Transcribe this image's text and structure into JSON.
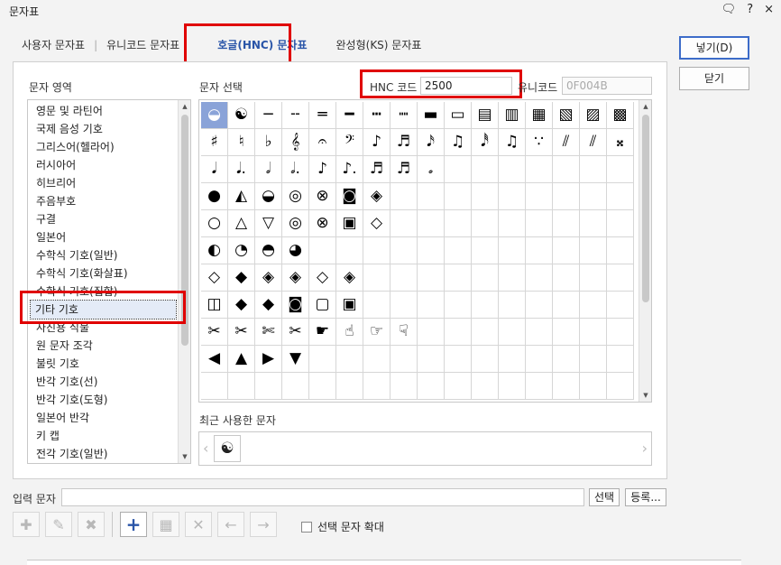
{
  "window": {
    "title": "문자표",
    "icons": [
      "?",
      "×"
    ]
  },
  "tabs": [
    {
      "label": "사용자 문자표",
      "active": false
    },
    {
      "label": "유니코드 문자표",
      "active": false
    },
    {
      "label": "호글(HNC) 문자표",
      "active": true
    },
    {
      "label": "완성형(KS) 문자표",
      "active": false
    }
  ],
  "labels": {
    "region": "문자 영역",
    "select": "문자 선택",
    "hnc_code": "HNC 코드",
    "unicode": "유니코드",
    "recent": "최근 사용한 문자",
    "input": "입력 문자"
  },
  "inputs": {
    "hnc_code": "2500",
    "unicode": "0F004B",
    "input_text": ""
  },
  "regions": [
    "영문 및 라틴어",
    "국제 음성 기호",
    "그리스어(헬라어)",
    "러시아어",
    "히브리어",
    "주음부호",
    "구결",
    "일본어",
    "수학식 기호(일반)",
    "수학식 기호(화살표)",
    "수학식 기호(집합)",
    "기타 기호",
    "사진용 식물",
    "원 문자 조각",
    "불릿 기호",
    "반각 기호(선)",
    "반각 기호(도형)",
    "일본어 반각",
    "키 캡",
    "전각 기호(일반)"
  ],
  "selected_region": "기타 기호",
  "grid_rows": [
    [
      "◒",
      "☯",
      "─",
      "╌",
      "═",
      "━",
      "┅",
      "┉",
      "▬",
      "▭",
      "▤",
      "▥",
      "▦",
      "▧",
      "▨",
      "▩"
    ],
    [
      "♯",
      "♮",
      "♭",
      "𝄞",
      "𝄐",
      "𝄢",
      "♪",
      "♬",
      "𝅘𝅥𝅯",
      "♫",
      "𝅘𝅥𝅰",
      "♫",
      "∵",
      "⫽",
      "⫽",
      "𝄪"
    ],
    [
      "𝅘𝅥",
      "𝅘𝅥.",
      "𝅗𝅥",
      "𝅗𝅥.",
      "♪",
      "♪.",
      "♬",
      "♬",
      "𝅗",
      "",
      "",
      "",
      "",
      "",
      "",
      ""
    ],
    [
      "●",
      "◭",
      "◒",
      "◎",
      "⊗",
      "◙",
      "◈",
      "",
      "",
      "",
      "",
      "",
      "",
      "",
      "",
      ""
    ],
    [
      "○",
      "△",
      "▽",
      "◎",
      "⊗",
      "▣",
      "◇",
      "",
      "",
      "",
      "",
      "",
      "",
      "",
      "",
      ""
    ],
    [
      "◐",
      "◔",
      "◓",
      "◕",
      "",
      "",
      "",
      "",
      "",
      "",
      "",
      "",
      "",
      "",
      "",
      ""
    ],
    [
      "◇",
      "◆",
      "◈",
      "◈",
      "◇",
      "◈",
      "",
      "",
      "",
      "",
      "",
      "",
      "",
      "",
      "",
      ""
    ],
    [
      "◫",
      "◆",
      "◆",
      "◙",
      "▢",
      "▣",
      "",
      "",
      "",
      "",
      "",
      "",
      "",
      "",
      "",
      ""
    ],
    [
      "✂",
      "✂",
      "✄",
      "✂",
      "☛",
      "☝",
      "☞",
      "☟",
      "",
      "",
      "",
      "",
      "",
      "",
      "",
      ""
    ],
    [
      "◀",
      "▲",
      "▶",
      "▼",
      "",
      "",
      "",
      "",
      "",
      "",
      "",
      "",
      "",
      "",
      "",
      ""
    ],
    [
      "",
      "",
      "",
      "",
      "",
      "",
      "",
      "",
      "",
      "",
      "",
      "",
      "",
      "",
      "",
      ""
    ]
  ],
  "recent_chars": [
    "☯"
  ],
  "buttons": {
    "insert": "넣기(D)",
    "close": "닫기",
    "select": "선택",
    "register": "등록..."
  },
  "toolbar_icons": [
    "add-char-icon",
    "edit-char-icon",
    "delete-char-icon",
    "new-icon",
    "table-add-icon",
    "delete-icon",
    "left-arrow-icon",
    "right-arrow-icon"
  ],
  "checkbox_label": "선택 문자 확대",
  "colors": {
    "accent": "#2a55a8",
    "highlight": "#e00000",
    "selection": "#8aa3d8"
  }
}
